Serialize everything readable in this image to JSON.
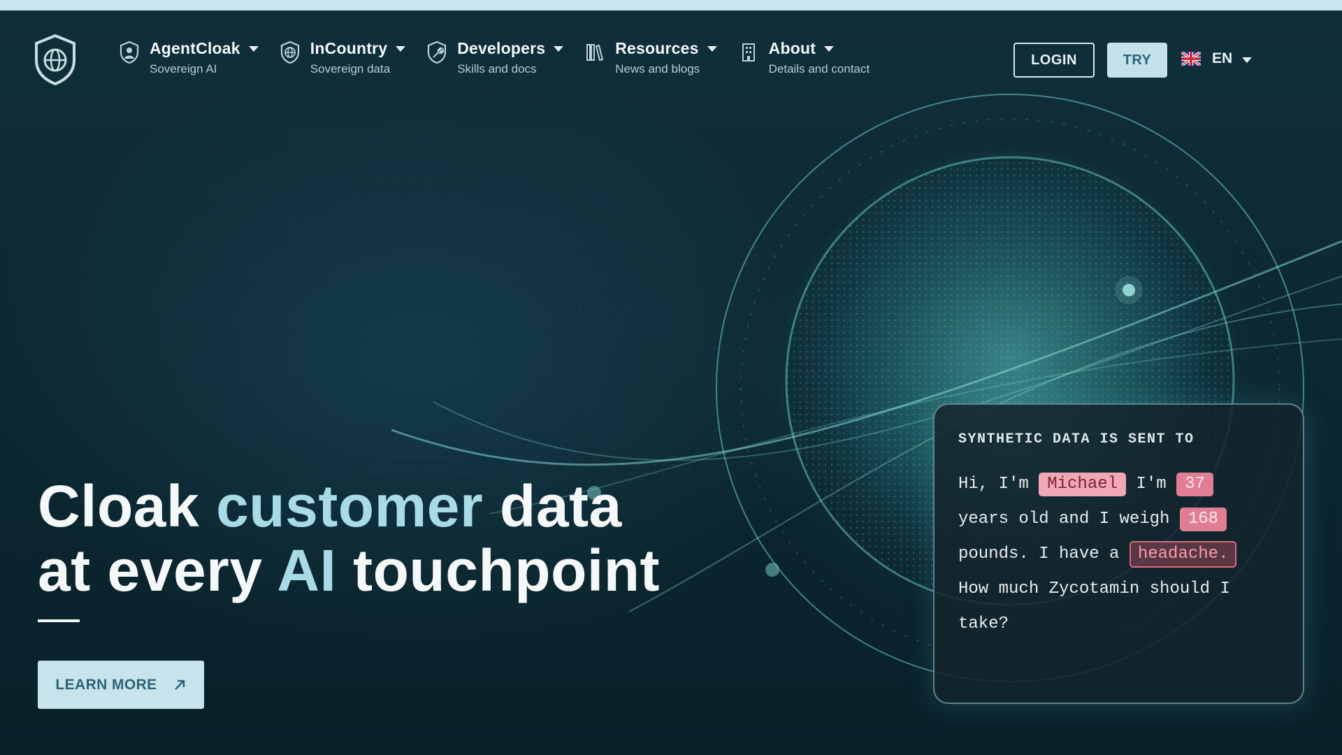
{
  "nav": {
    "items": [
      {
        "title": "AgentCloak",
        "subtitle": "Sovereign AI",
        "icon": "agent-shield-icon"
      },
      {
        "title": "InCountry",
        "subtitle": "Sovereign data",
        "icon": "globe-shield-icon"
      },
      {
        "title": "Developers",
        "subtitle": "Skills and docs",
        "icon": "wrench-shield-icon"
      },
      {
        "title": "Resources",
        "subtitle": "News and blogs",
        "icon": "books-icon"
      },
      {
        "title": "About",
        "subtitle": "Details and contact",
        "icon": "building-icon"
      }
    ],
    "login_label": "LOGIN",
    "try_label": "TRY",
    "language": "EN",
    "language_flag": "uk-flag-icon"
  },
  "hero": {
    "line1_a": "Cloak ",
    "line1_b": "customer",
    "line1_c": " data",
    "line2_a": "at every ",
    "line2_b": "AI",
    "line2_c": " touchpoint",
    "cta_label": "LEARN MORE"
  },
  "card": {
    "heading": "SYNTHETIC DATA IS SENT TO",
    "text_1": "Hi, I'm ",
    "name": "Michael",
    "text_2": " I'm ",
    "age": "37",
    "text_3": "years old and I weigh ",
    "weight": "168",
    "text_4": "pounds. I have a ",
    "symptom": "headache.",
    "text_5": "How much Zycotamin should I take?"
  },
  "colors": {
    "background": "#0d2a35",
    "accent_text": "#a8dbe6",
    "button_bg": "#c7e4ec",
    "button_text": "#2d6377",
    "tag_pink": "#f0a8b6"
  }
}
